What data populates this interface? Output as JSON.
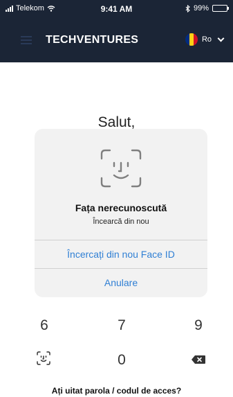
{
  "status_bar": {
    "carrier": "Telekom",
    "time": "9:41 AM",
    "battery": "99%",
    "battery_level": 0.99
  },
  "header": {
    "title": "TECHVENTURES",
    "language": "Ro",
    "icons": [
      "menu-icon",
      "romania-flag-icon",
      "chevron-down-icon"
    ]
  },
  "main": {
    "greeting": "Salut,"
  },
  "faceid_dialog": {
    "title": "Fața nerecunoscută",
    "subtitle": "Încearcă din nou",
    "retry_label": "Încercați din nou Face ID",
    "cancel_label": "Anulare",
    "icon": "face-id-icon"
  },
  "keypad": {
    "keys": [
      "6",
      "7",
      "9",
      "0"
    ],
    "icons": [
      "face-id-key-icon",
      "backspace-icon"
    ]
  },
  "footer": {
    "forgot_link": "Ați uitat parola / codul de acces?"
  },
  "colors": {
    "header_bg": "#1b2536",
    "accent": "#2f7fd4",
    "dialog_bg": "#f2f2f2"
  }
}
